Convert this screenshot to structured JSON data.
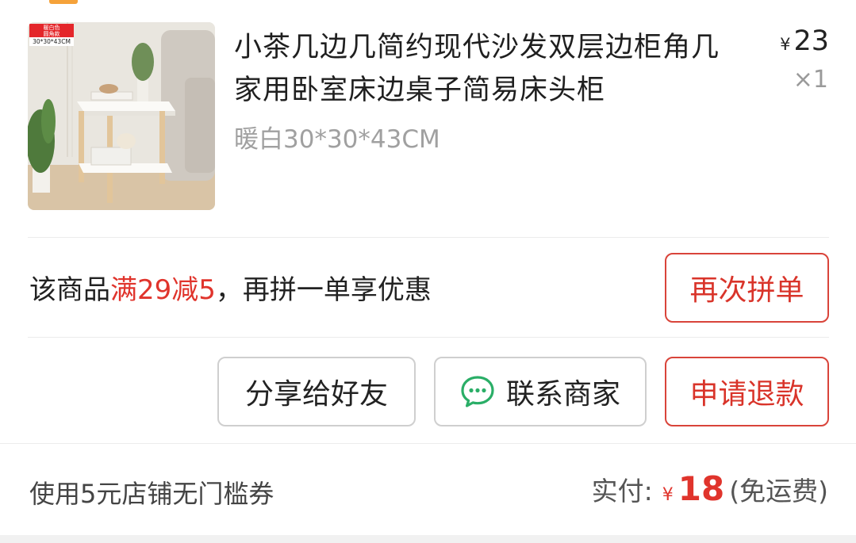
{
  "product": {
    "image_tag_color": "暖白色",
    "image_tag_style": "圆角款",
    "image_tag_size": "30*30*43CM",
    "title": "小茶几边几简约现代沙发双层边柜角几家用卧室床边桌子简易床头柜",
    "spec": "暖白30*30*43CM",
    "currency": "¥",
    "price": "23",
    "quantity": "×1"
  },
  "promo": {
    "prefix": "该商品",
    "highlight": "满29减5",
    "suffix": "，再拼一单享优惠",
    "button_label": "再次拼单"
  },
  "actions": {
    "share_label": "分享给好友",
    "contact_label": "联系商家",
    "refund_label": "申请退款"
  },
  "footer": {
    "coupon_text": "使用5元店铺无门槛券",
    "paid_label": "实付:",
    "currency": "¥",
    "paid_amount": "18",
    "shipping_note": "(免运费)"
  },
  "colors": {
    "accent_red": "#e0342c",
    "wechat_green": "#2aae67"
  },
  "icons": [
    "wechat-chat-icon"
  ]
}
